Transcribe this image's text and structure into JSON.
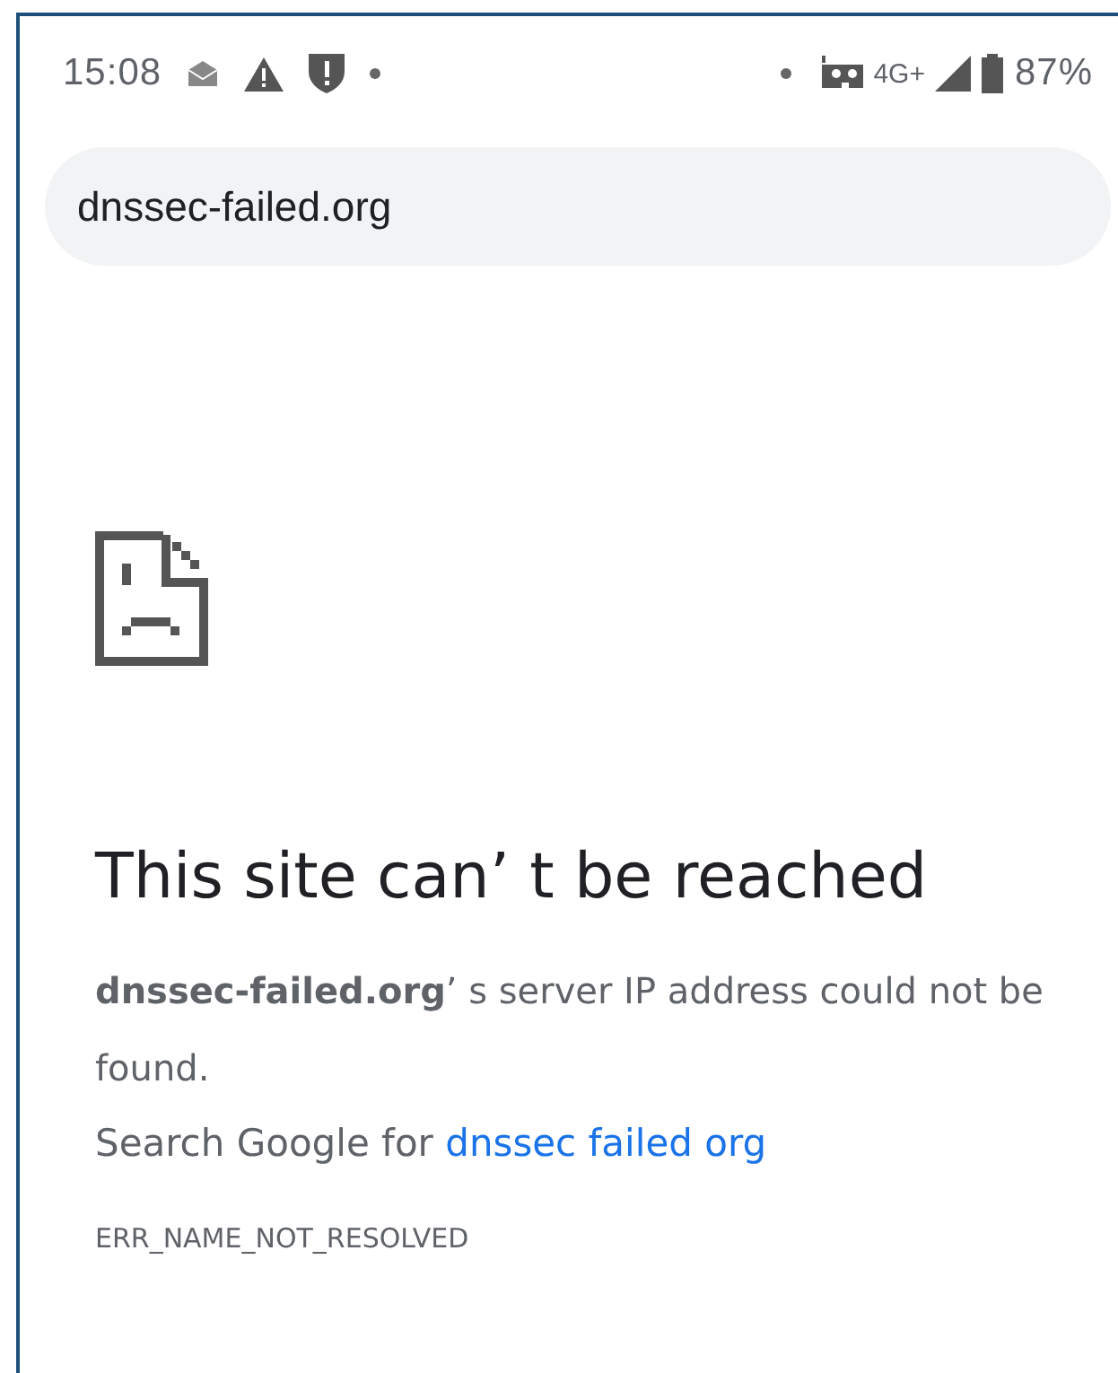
{
  "status_bar": {
    "time": "15:08",
    "network": "4G+",
    "battery": "87%"
  },
  "address_bar": {
    "url": "dnssec-failed.org"
  },
  "error_page": {
    "heading": "This site can’ t be reached",
    "message": "**dnssec-failed.org**’ s server IP address could not be found.",
    "search_prefix": "Search Google for ",
    "search_link": "dnssec failed org",
    "error_code": "ERR_NAME_NOT_RESOLVED"
  }
}
